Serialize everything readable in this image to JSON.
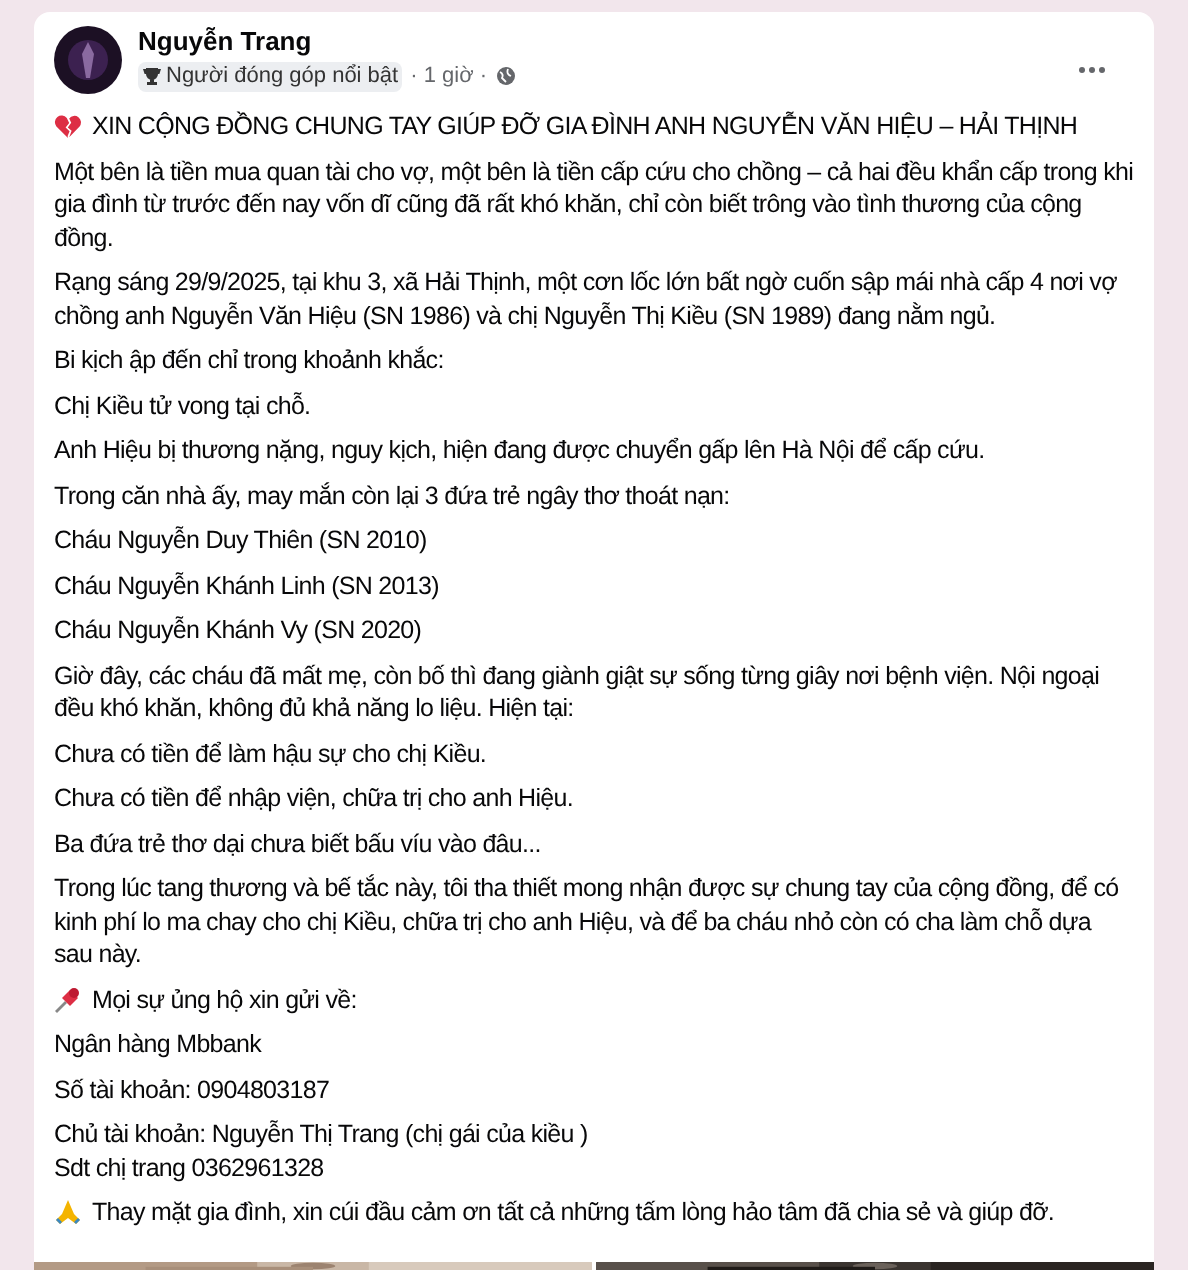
{
  "post": {
    "author": "Nguyễn Trang",
    "badge": "Người đóng góp nổi bật",
    "time": "· 1 giờ ·",
    "paragraphs": [
      {
        "kind": "alert",
        "lines": [
          "XIN CỘNG ĐỒNG CHUNG TAY GIÚP ĐỠ GIA ĐÌNH ANH NGUYỄN VĂN HIỆU – HẢI THỊNH"
        ]
      },
      {
        "kind": "text",
        "lines": [
          "Một bên là tiền mua quan tài cho vợ, một bên là tiền cấp cứu cho chồng – cả hai đều khẩn cấp trong khi gia đình từ trước đến nay vốn dĩ cũng đã rất khó khăn, chỉ còn biết trông vào tình thương của cộng đồng."
        ]
      },
      {
        "kind": "text",
        "lines": [
          "Rạng sáng 29/9/2025, tại khu 3, xã Hải Thịnh, một cơn lốc lớn bất ngờ cuốn sập mái nhà cấp 4 nơi vợ chồng anh Nguyễn Văn Hiệu (SN 1986) và chị Nguyễn Thị Kiều (SN 1989) đang nằm ngủ."
        ]
      },
      {
        "kind": "text",
        "lines": [
          "Bi kịch ập đến chỉ trong khoảnh khắc:"
        ]
      },
      {
        "kind": "text",
        "lines": [
          "Chị Kiều tử vong tại chỗ."
        ]
      },
      {
        "kind": "text",
        "lines": [
          "Anh Hiệu bị thương nặng, nguy kịch, hiện đang được chuyển gấp lên Hà Nội để cấp cứu."
        ]
      },
      {
        "kind": "text",
        "lines": [
          "Trong căn nhà ấy, may mắn còn lại 3 đứa trẻ ngây thơ thoát nạn:"
        ]
      },
      {
        "kind": "text",
        "lines": [
          "Cháu Nguyễn Duy Thiên (SN 2010)"
        ]
      },
      {
        "kind": "text",
        "lines": [
          "Cháu Nguyễn Khánh Linh (SN 2013)"
        ]
      },
      {
        "kind": "text",
        "lines": [
          "Cháu Nguyễn Khánh Vy (SN 2020)"
        ]
      },
      {
        "kind": "text",
        "lines": [
          "Giờ đây, các cháu đã mất mẹ, còn bố thì đang giành giật sự sống từng giây nơi bệnh viện. Nội ngoại đều khó khăn, không đủ khả năng lo liệu. Hiện tại:"
        ]
      },
      {
        "kind": "text",
        "lines": [
          "Chưa có tiền để làm hậu sự cho chị Kiều."
        ]
      },
      {
        "kind": "text",
        "lines": [
          "Chưa có tiền để nhập viện, chữa trị cho anh Hiệu."
        ]
      },
      {
        "kind": "text",
        "lines": [
          "Ba đứa trẻ thơ dại chưa biết bấu víu vào đâu..."
        ]
      },
      {
        "kind": "text",
        "lines": [
          "Trong lúc tang thương và bế tắc này, tôi tha thiết mong nhận được sự chung tay của cộng đồng, để có kinh phí lo ma chay cho chị Kiều, chữa trị cho anh Hiệu, và để ba cháu nhỏ còn có cha làm chỗ dựa sau này."
        ]
      },
      {
        "kind": "pin",
        "lines": [
          "Mọi sự ủng hộ xin gửi về:"
        ]
      },
      {
        "kind": "text",
        "lines": [
          "Ngân hàng Mbbank"
        ]
      },
      {
        "kind": "text",
        "lines": [
          "Số tài khoản: 0904803187"
        ]
      },
      {
        "kind": "text",
        "lines": [
          "Chủ tài khoản: Nguyễn Thị Trang (chị gái của kiều )",
          "Sdt chị trang 0362961328"
        ]
      },
      {
        "kind": "thanks",
        "lines": [
          "Thay mặt gia đình, xin cúi đầu cảm ơn tất cả những tấm lòng hảo tâm đã chia sẻ và giúp đỡ."
        ]
      }
    ]
  }
}
